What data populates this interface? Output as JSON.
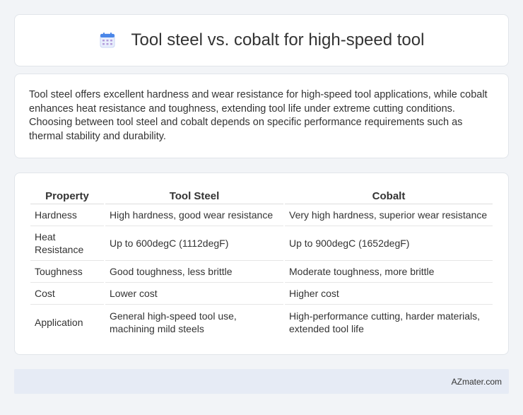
{
  "header": {
    "title": "Tool steel vs. cobalt for high-speed tool",
    "icon": "calendar-icon",
    "icon_colors": {
      "top": "#4a86e8",
      "body": "#e8eefc",
      "dots": "#b39ddb"
    }
  },
  "summary": {
    "text": "Tool steel offers excellent hardness and wear resistance for high-speed tool applications, while cobalt enhances heat resistance and toughness, extending tool life under extreme cutting conditions. Choosing between tool steel and cobalt depends on specific performance requirements such as thermal stability and durability."
  },
  "table": {
    "headers": [
      "Property",
      "Tool Steel",
      "Cobalt"
    ],
    "rows": [
      [
        "Hardness",
        "High hardness, good wear resistance",
        "Very high hardness, superior wear resistance"
      ],
      [
        "Heat Resistance",
        "Up to 600degC (1112degF)",
        "Up to 900degC (1652degF)"
      ],
      [
        "Toughness",
        "Good toughness, less brittle",
        "Moderate toughness, more brittle"
      ],
      [
        "Cost",
        "Lower cost",
        "Higher cost"
      ],
      [
        "Application",
        "General high-speed tool use, machining mild steels",
        "High-performance cutting, harder materials, extended tool life"
      ]
    ]
  },
  "footer": {
    "text": "AZmater.com"
  }
}
